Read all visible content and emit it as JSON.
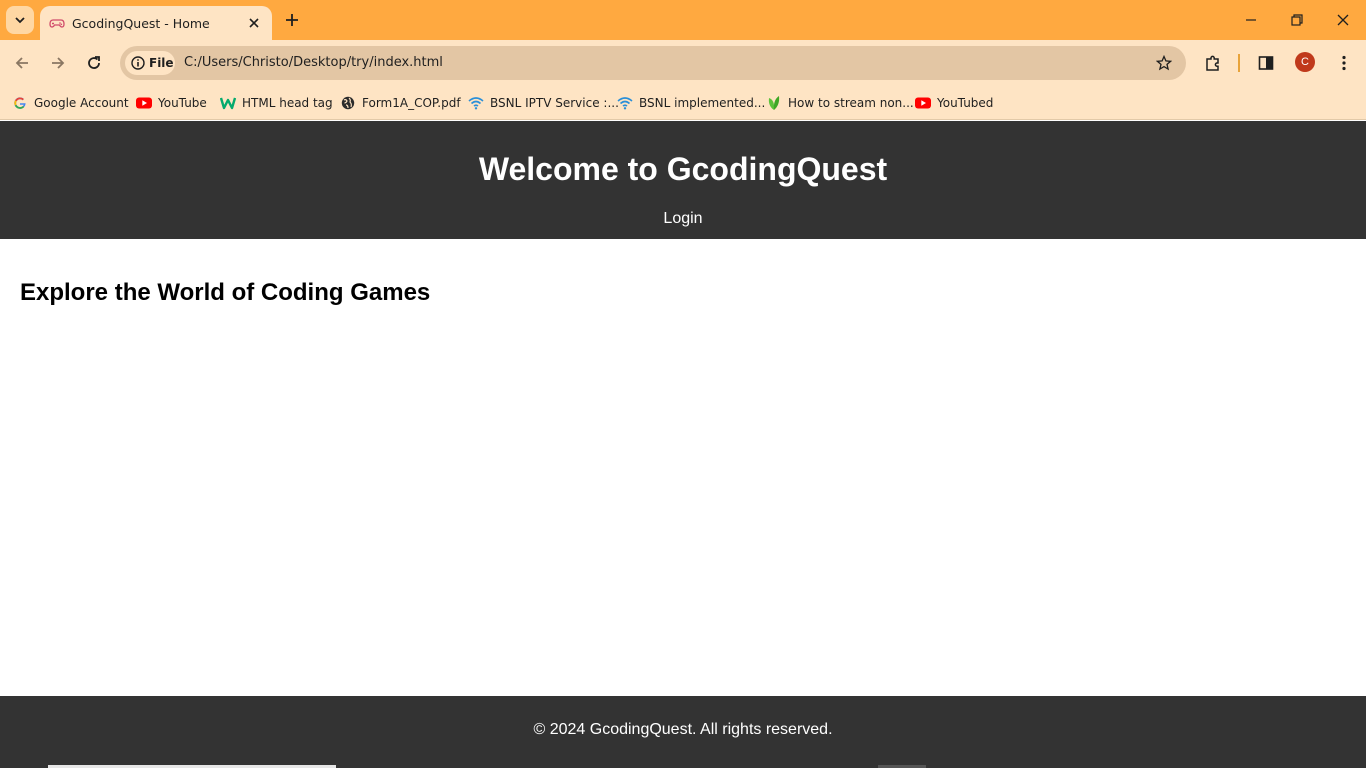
{
  "browser": {
    "tab": {
      "title": "GcodingQuest - Home"
    },
    "address_bar": {
      "chip_label": "File",
      "url": "C:/Users/Christo/Desktop/try/index.html"
    },
    "profile_initial": "C",
    "icons": {
      "tab_search": "chevron-down-icon",
      "favicon": "gamepad-icon",
      "close": "close-icon",
      "new_tab": "plus-icon",
      "back": "arrow-left-icon",
      "forward": "arrow-right-icon",
      "reload": "reload-icon",
      "info": "info-icon",
      "bookmark_star": "star-icon",
      "extensions": "puzzle-icon",
      "side_panel": "side-panel-icon",
      "menu": "kebab-menu-icon"
    },
    "colors": {
      "titlebar": "#ffa940",
      "toolbar": "#fee4c4",
      "omnibox": "#e3c6a4",
      "avatar": "#c0391b"
    },
    "bookmarks": [
      {
        "label": "Google Account",
        "icon": "google-icon"
      },
      {
        "label": "YouTube",
        "icon": "youtube-icon"
      },
      {
        "label": "HTML head tag",
        "icon": "w-logo-icon"
      },
      {
        "label": "Form1A_COP.pdf",
        "icon": "globe-icon"
      },
      {
        "label": "BSNL IPTV Service :...",
        "icon": "wifi-icon"
      },
      {
        "label": "BSNL implemented...",
        "icon": "wifi-icon"
      },
      {
        "label": "How to stream non...",
        "icon": "leaf-icon"
      },
      {
        "label": "YouTubed",
        "icon": "youtube-icon"
      }
    ]
  },
  "page": {
    "header": {
      "title": "Welcome to GcodingQuest",
      "nav": {
        "login": "Login"
      }
    },
    "main": {
      "heading": "Explore the World of Coding Games"
    },
    "footer": {
      "text": "© 2024 GcodingQuest. All rights reserved."
    },
    "colors": {
      "header_bg": "#333333",
      "footer_bg": "#333333"
    }
  }
}
